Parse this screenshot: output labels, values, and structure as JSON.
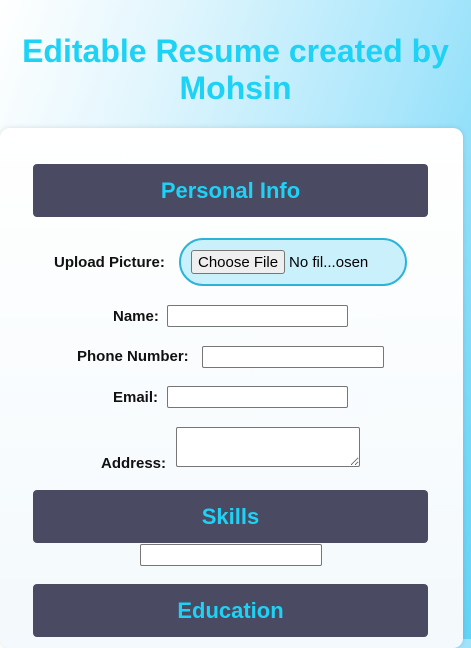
{
  "page": {
    "title": "Editable Resume created by Mohsin"
  },
  "sections": {
    "personal_info": "Personal Info",
    "skills": "Skills",
    "education": "Education"
  },
  "form": {
    "upload_label": "Upload Picture:",
    "file_button": "Choose File",
    "file_status": "No fil...osen",
    "name_label": "Name:",
    "name_value": "",
    "phone_label": "Phone Number:",
    "phone_value": "",
    "email_label": "Email:",
    "email_value": "",
    "address_label": "Address:",
    "address_value": "",
    "skills_value": ""
  },
  "colors": {
    "accent": "#1dd2f5",
    "section_bg": "#4a4a63",
    "file_wrap_bg": "#c9f0fb",
    "file_wrap_border": "#2bb4d8"
  }
}
